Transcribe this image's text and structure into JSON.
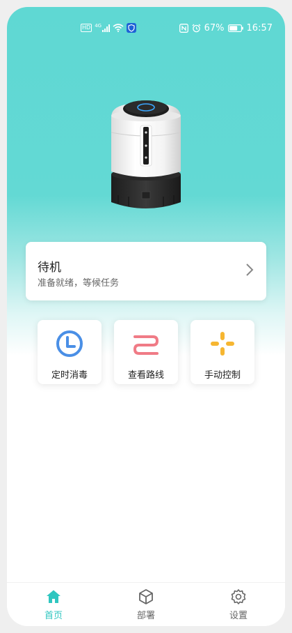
{
  "status_bar": {
    "network_type": "HD",
    "signal_gen": "4G",
    "battery": "67%",
    "time": "16:57"
  },
  "device": {
    "status_title": "待机",
    "status_subtitle": "准备就绪，等候任务"
  },
  "actions": [
    {
      "label": "定时消毒",
      "icon": "clock-icon",
      "color": "#4a8fe6"
    },
    {
      "label": "查看路线",
      "icon": "route-icon",
      "color": "#f07b86"
    },
    {
      "label": "手动控制",
      "icon": "dpad-icon",
      "color": "#f6b631"
    }
  ],
  "tabs": [
    {
      "label": "首页",
      "icon": "home-icon",
      "active": true
    },
    {
      "label": "部署",
      "icon": "cube-icon",
      "active": false
    },
    {
      "label": "设置",
      "icon": "gear-icon",
      "active": false
    }
  ],
  "colors": {
    "accent": "#2fc6c0",
    "header_bg": "#5fd8d3"
  }
}
